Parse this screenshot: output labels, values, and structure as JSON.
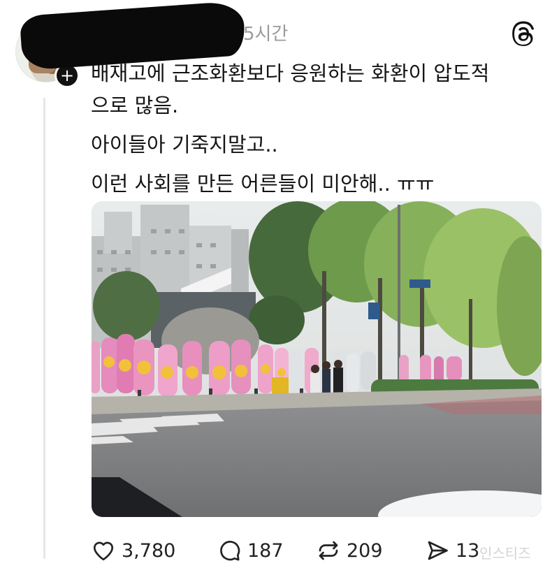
{
  "post": {
    "timestamp": "5시간",
    "text_lines": [
      "배재고에 근조화환보다 응원하는 화환이 압도적",
      "으로 많음.",
      "아이들아 기죽지말고..",
      "이런 사회를 만든 어른들이 미안해.. ㅠㅠ"
    ]
  },
  "actions": {
    "likes": "3,780",
    "comments": "187",
    "reposts": "209",
    "shares": "13"
  },
  "watermark": "인스티즈",
  "icons": {
    "threads": "threads-logo-icon",
    "like": "heart-icon",
    "comment": "comment-bubble-icon",
    "repost": "repost-icon",
    "share": "send-icon",
    "follow": "plus-icon"
  }
}
